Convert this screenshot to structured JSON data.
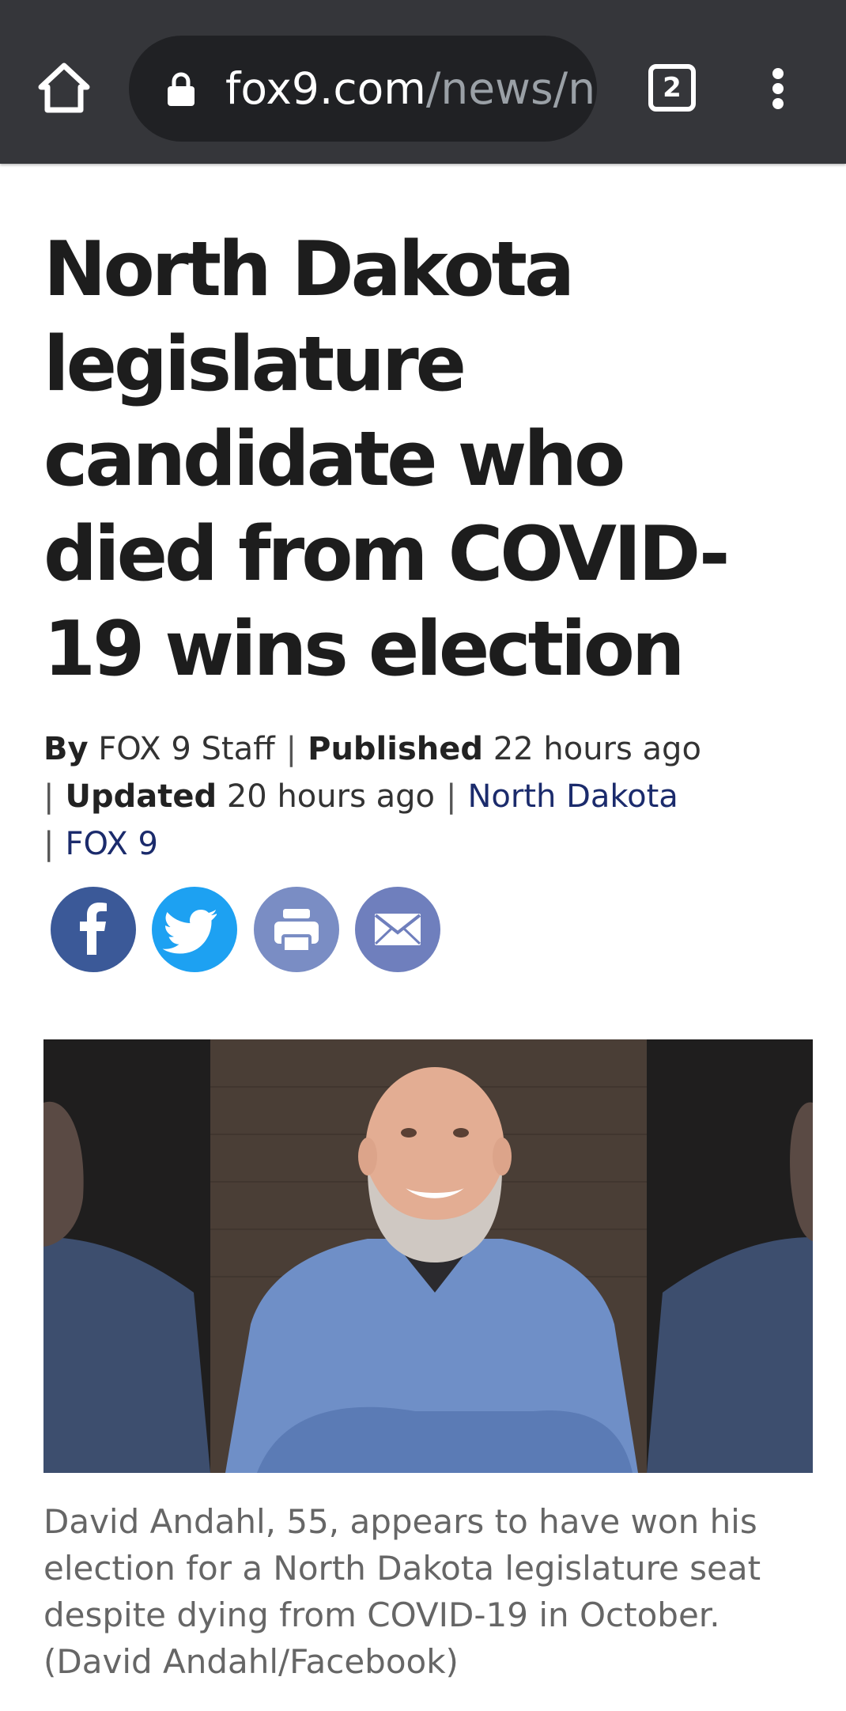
{
  "browser": {
    "url_domain": "fox9.com",
    "url_path": "/news/n",
    "tab_count": "2",
    "icons": [
      "home-icon",
      "lock-icon",
      "tab-switcher-icon",
      "more-vert-icon"
    ]
  },
  "article": {
    "headline": "North Dakota legislature candidate who died from COVID-19 wins election",
    "byline": {
      "by_label": "By",
      "author": "FOX 9 Staff",
      "published_label": "Published",
      "published_time": "22 hours ago",
      "updated_label": "Updated",
      "updated_time": "20 hours ago",
      "tag_1": "North Dakota",
      "tag_2": "FOX 9",
      "separator": "|"
    },
    "share_icons": [
      "facebook-icon",
      "twitter-icon",
      "print-icon",
      "email-icon"
    ],
    "caption": "David Andahl, 55, appears to have won his election for a North Dakota legislature seat despite dying from COVID-19 in October. (David Andahl/Facebook)"
  },
  "colors": {
    "toolbar": "#35363a",
    "url_pill": "#202124",
    "facebook": "#3b5998",
    "twitter": "#1da1f2",
    "print": "#7a8dc4",
    "email": "#6f7fbd",
    "link": "#1b2b6c"
  }
}
